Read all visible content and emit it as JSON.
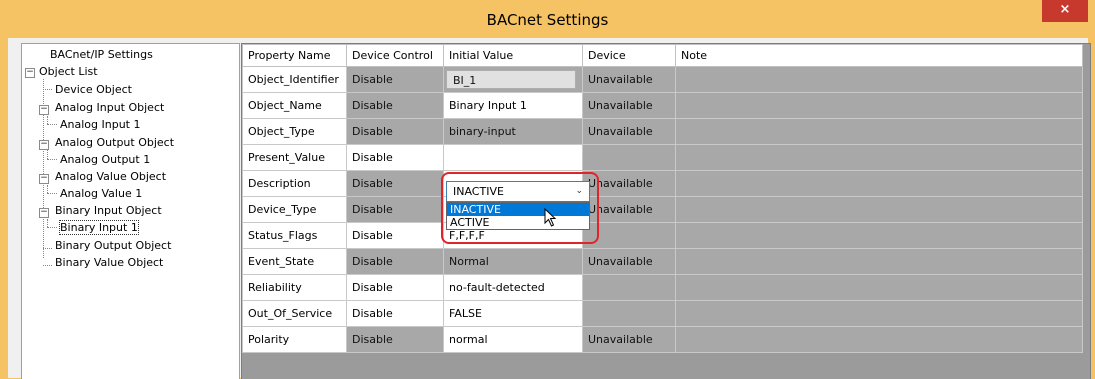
{
  "window": {
    "title": "BACnet Settings",
    "close_glyph": "×"
  },
  "tree": {
    "root": "BACnet/IP Settings",
    "object_list": "Object List",
    "items": [
      {
        "label": "Device Object"
      },
      {
        "label": "Analog Input Object"
      },
      {
        "label": "Analog Input 1"
      },
      {
        "label": "Analog Output Object"
      },
      {
        "label": "Analog Output 1"
      },
      {
        "label": "Analog Value Object"
      },
      {
        "label": "Analog Value 1"
      },
      {
        "label": "Binary Input Object"
      },
      {
        "label": "Binary Input 1"
      },
      {
        "label": "Binary Output Object"
      },
      {
        "label": "Binary Value Object"
      }
    ],
    "expanders": {
      "minus": "−"
    }
  },
  "grid": {
    "headers": [
      "Property Name",
      "Device Control",
      "Initial Value",
      "Device",
      "Note"
    ],
    "rows": [
      {
        "name": "Object_Identifier",
        "control": "Disable",
        "initial": "BI_1",
        "device": "Unavailable"
      },
      {
        "name": "Object_Name",
        "control": "Disable",
        "initial": "Binary Input 1",
        "device": "Unavailable"
      },
      {
        "name": "Object_Type",
        "control": "Disable",
        "initial": "binary-input",
        "device": "Unavailable"
      },
      {
        "name": "Present_Value",
        "control": "Disable",
        "initial": "INACTIVE",
        "device": ""
      },
      {
        "name": "Description",
        "control": "Disable",
        "initial": "",
        "device": "Unavailable"
      },
      {
        "name": "Device_Type",
        "control": "Disable",
        "initial": "",
        "device": "Unavailable"
      },
      {
        "name": "Status_Flags",
        "control": "Disable",
        "initial": "F,F,F,F",
        "device": ""
      },
      {
        "name": "Event_State",
        "control": "Disable",
        "initial": "Normal",
        "device": "Unavailable"
      },
      {
        "name": "Reliability",
        "control": "Disable",
        "initial": "no-fault-detected",
        "device": ""
      },
      {
        "name": "Out_Of_Service",
        "control": "Disable",
        "initial": "FALSE",
        "device": ""
      },
      {
        "name": "Polarity",
        "control": "Disable",
        "initial": "normal",
        "device": "Unavailable"
      }
    ]
  },
  "present_value_dropdown": {
    "selected": "INACTIVE",
    "arrow": "⌄",
    "options": [
      "INACTIVE",
      "ACTIVE"
    ],
    "highlighted_index": 0
  },
  "colors": {
    "titlebar": "#f5c363",
    "close": "#c7392d",
    "highlight": "#0078d7",
    "annotation": "#e0242c"
  }
}
